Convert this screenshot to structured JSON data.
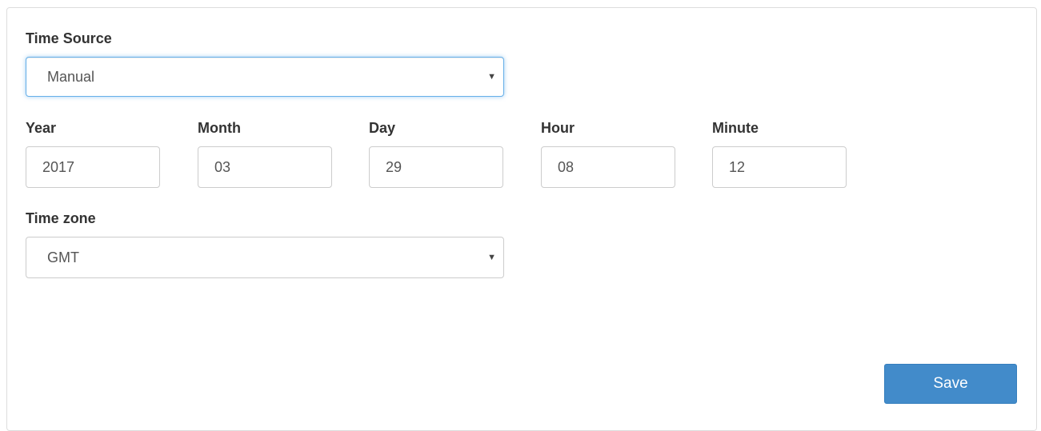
{
  "time_source": {
    "label": "Time Source",
    "selected": "Manual"
  },
  "datetime": {
    "year": {
      "label": "Year",
      "value": "2017"
    },
    "month": {
      "label": "Month",
      "value": "03"
    },
    "day": {
      "label": "Day",
      "value": "29"
    },
    "hour": {
      "label": "Hour",
      "value": "08"
    },
    "minute": {
      "label": "Minute",
      "value": "12"
    }
  },
  "time_zone": {
    "label": "Time zone",
    "selected": "GMT"
  },
  "actions": {
    "save_label": "Save"
  },
  "colors": {
    "primary": "#428bca",
    "focus_border": "#66afe9"
  },
  "icons": {
    "dropdown": "chevron-down-icon"
  }
}
